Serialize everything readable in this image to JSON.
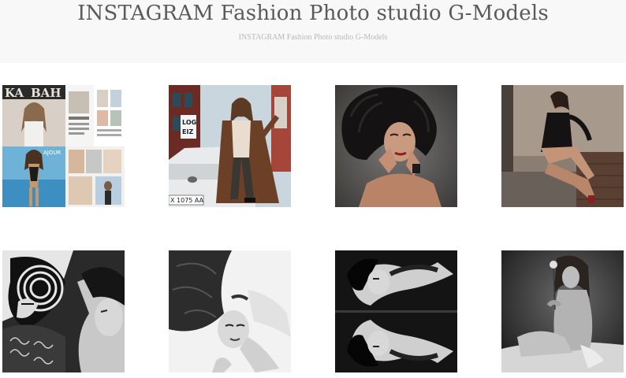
{
  "header": {
    "title": "INSTAGRAM Fashion Photo studio G-Models",
    "subtitle": "INSTAGRAM Fashion Photo studio G-Models"
  },
  "gallery": {
    "photos": [
      {
        "kind": "magazine-cover-collage",
        "mag_title": "KA",
        "mag_title2": "BAH",
        "caption": "AJOUR"
      },
      {
        "kind": "street-fashion-with-car",
        "sign": "LOG",
        "sign2": "EIZ",
        "plate": "X 1075 AA"
      },
      {
        "kind": "dark-hair-portrait"
      },
      {
        "kind": "seated-model-stone-wall"
      },
      {
        "kind": "bw-graphic-art"
      },
      {
        "kind": "bw-reclining-model"
      },
      {
        "kind": "bw-mirrored-pose"
      },
      {
        "kind": "bw-seated-model-flower"
      }
    ]
  }
}
